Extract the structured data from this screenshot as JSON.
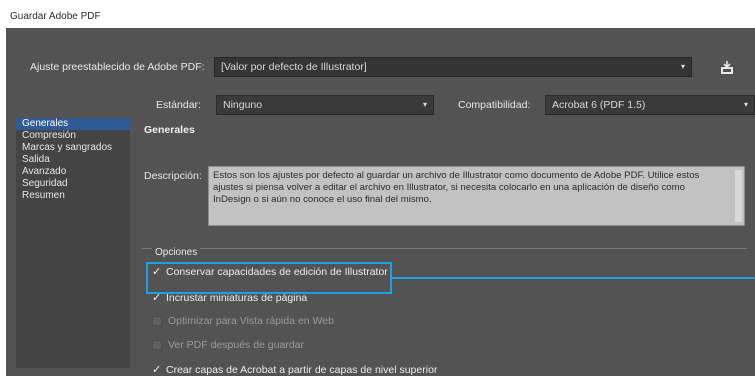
{
  "window": {
    "title": "Guardar Adobe PDF"
  },
  "preset": {
    "label": "Ajuste preestablecido de Adobe PDF:",
    "value": "[Valor por defecto de Illustrator]"
  },
  "standard": {
    "label": "Estándar:",
    "value": "Ninguno"
  },
  "compatibility": {
    "label": "Compatibilidad:",
    "value": "Acrobat 6 (PDF 1.5)"
  },
  "sidebar": {
    "items": [
      {
        "label": "Generales",
        "selected": true
      },
      {
        "label": "Compresión",
        "selected": false
      },
      {
        "label": "Marcas y sangrados",
        "selected": false
      },
      {
        "label": "Salida",
        "selected": false
      },
      {
        "label": "Avanzado",
        "selected": false
      },
      {
        "label": "Seguridad",
        "selected": false
      },
      {
        "label": "Resumen",
        "selected": false
      }
    ]
  },
  "general": {
    "title": "Generales",
    "description_label": "Descripción:",
    "description": "Estos son los ajustes por defecto al guardar un archivo de Illustrator como documento de Adobe PDF. Utilice estos ajustes si piensa volver a editar el archivo en Illustrator, si necesita colocarlo en una aplicación de diseño como InDesign o si aún no conoce el uso final del mismo."
  },
  "options": {
    "title": "Opciones",
    "items": [
      {
        "label": "Conservar capacidades de edición de Illustrator",
        "checked": true
      },
      {
        "label": "Incrustar miniaturas de página",
        "checked": true
      },
      {
        "label": "Optimizar para Vista rápida en Web",
        "checked": false
      },
      {
        "label": "Ver PDF después de guardar",
        "checked": false
      },
      {
        "label": "Crear capas de Acrobat a partir de capas de nivel superior",
        "checked": true
      }
    ]
  },
  "colors": {
    "dialog_bg": "#535353",
    "selection": "#2f5a96",
    "highlight": "#1aa3e0"
  },
  "icons": {
    "dropdown": "chevron-down-icon",
    "save_preset": "save-preset-icon",
    "check": "checkmark-icon"
  },
  "glyphs": {
    "arrow": "▾",
    "check": "✓"
  }
}
